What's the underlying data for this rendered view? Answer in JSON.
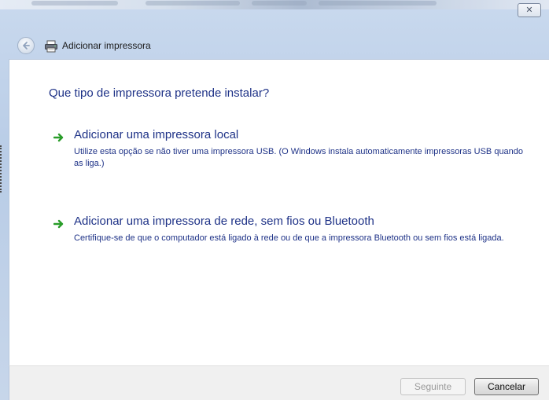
{
  "window": {
    "title": "Adicionar impressora",
    "close_symbol": "✕"
  },
  "nav": {
    "back_icon": "back-arrow-icon",
    "title_icon": "printer-icon"
  },
  "main": {
    "question": "Que tipo de impressora pretende instalar?",
    "options": [
      {
        "title": "Adicionar uma impressora local",
        "description": "Utilize esta opção se não tiver uma impressora USB. (O Windows instala automaticamente impressoras USB quando as liga.)",
        "icon": "green-arrow-icon"
      },
      {
        "title": "Adicionar uma impressora de rede, sem fios ou Bluetooth",
        "description": "Certifique-se de que o computador está ligado à rede ou de que a impressora Bluetooth ou sem fios está ligada.",
        "icon": "green-arrow-icon"
      }
    ]
  },
  "footer": {
    "next_label": "Seguinte",
    "cancel_label": "Cancelar"
  },
  "colors": {
    "accent_text": "#1e3287",
    "arrow_green": "#2a9d2a",
    "chrome": "#c9d9ee"
  }
}
